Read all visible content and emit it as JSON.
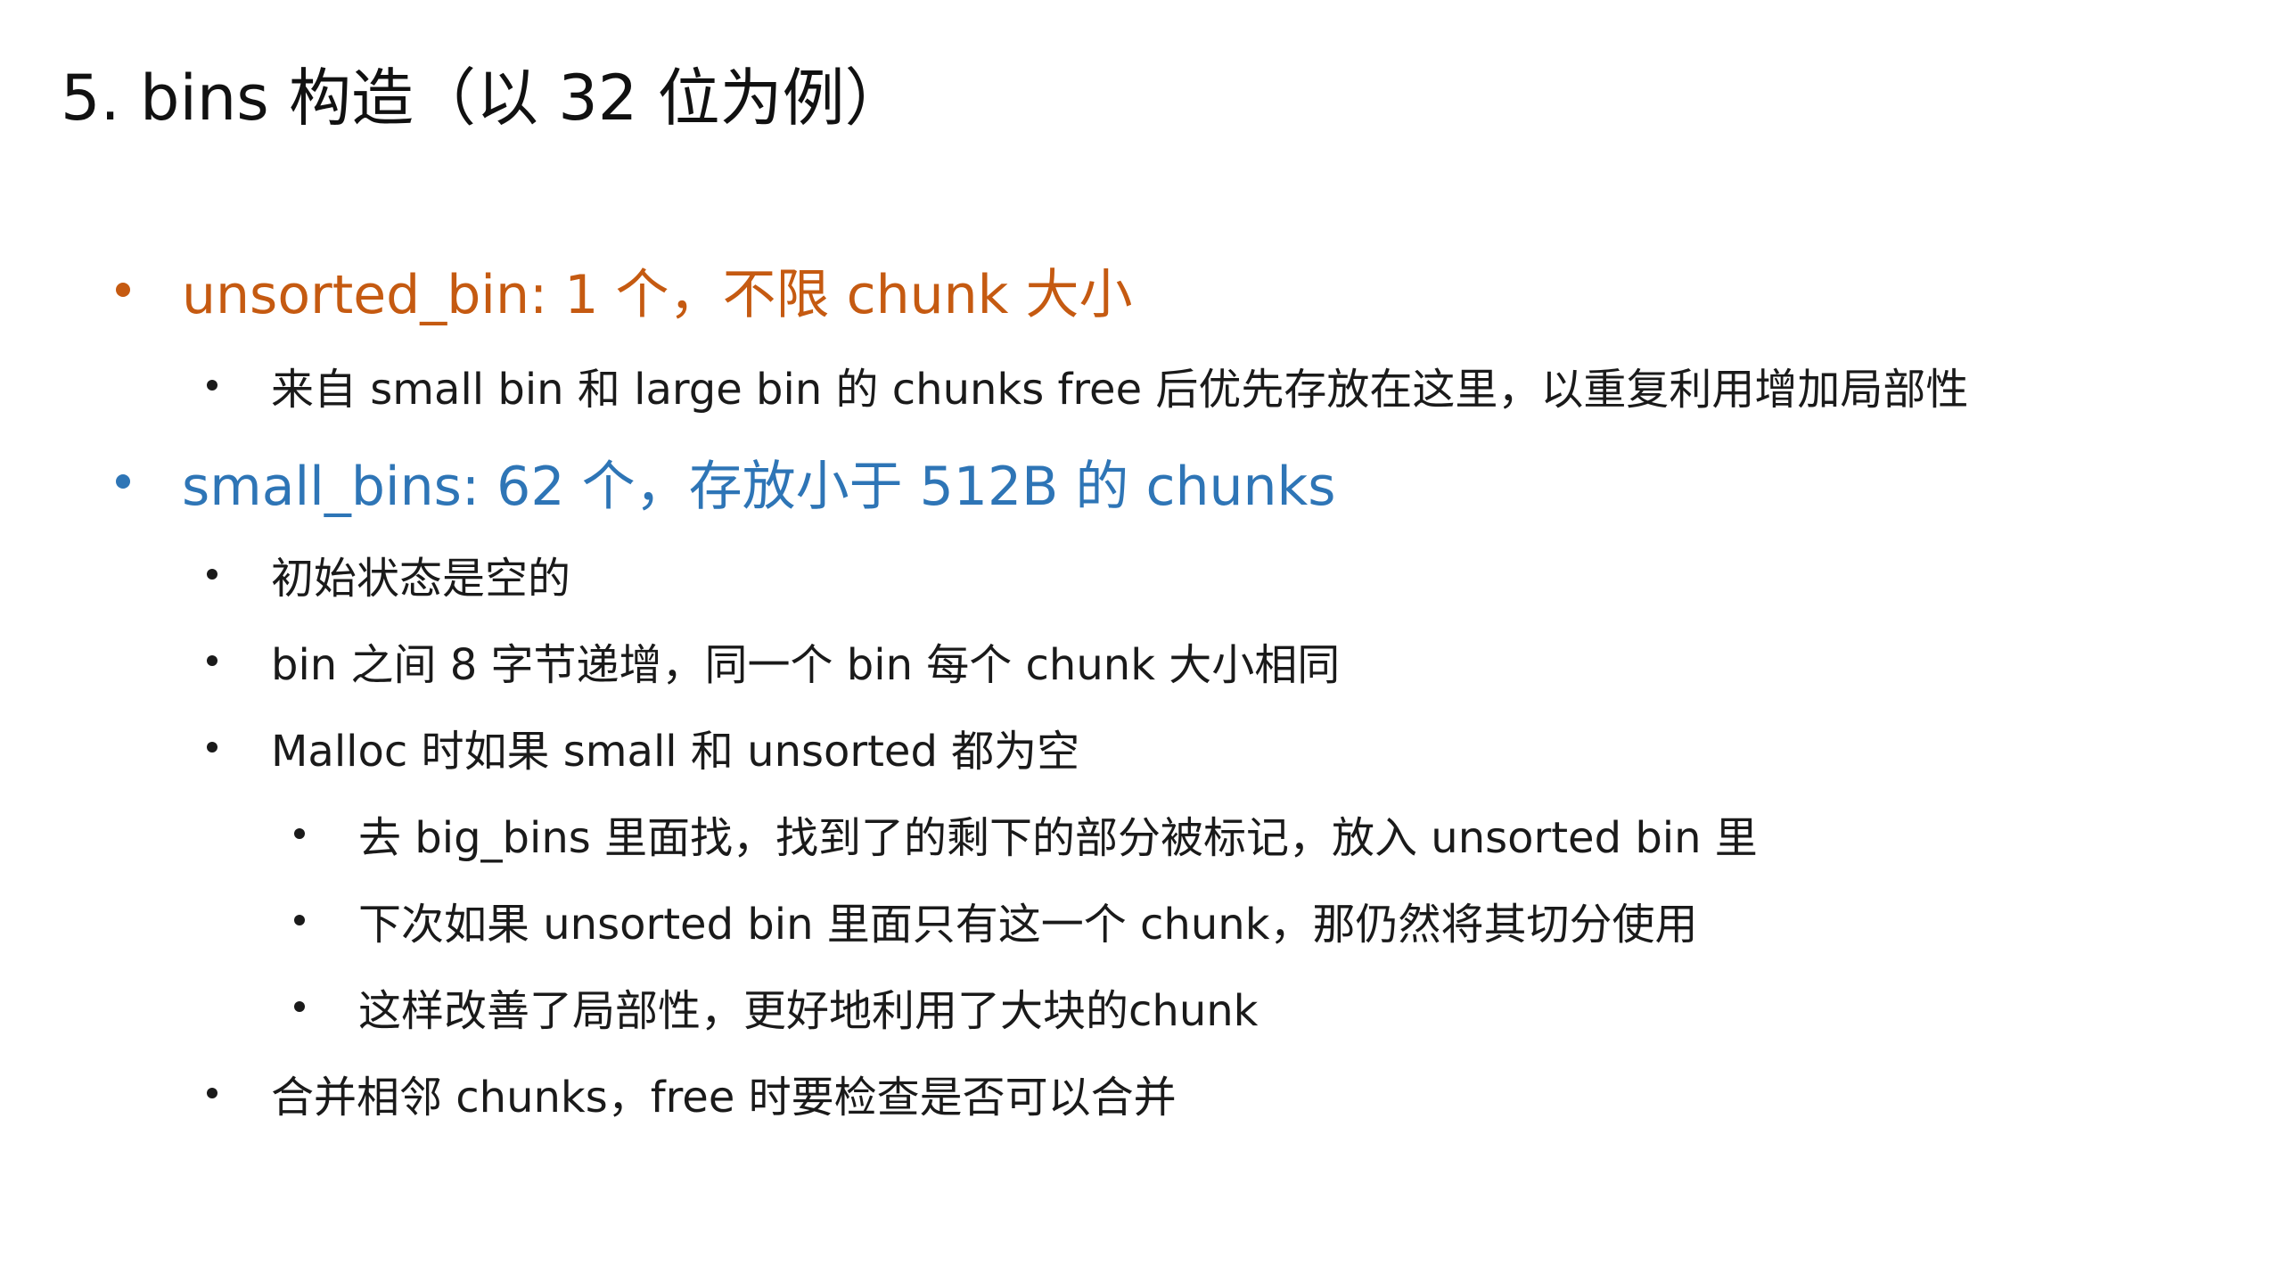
{
  "slide": {
    "title": "5. bins 构造（以 32 位为例）",
    "colors": {
      "accent_orange": "#c55a11",
      "accent_blue": "#2e75b6",
      "text": "#1a1a1a"
    },
    "bullets": [
      {
        "level": 1,
        "color": "#c55a11",
        "text": "unsorted_bin: 1 个，不限 chunk 大小"
      },
      {
        "level": 2,
        "text": "来自 small bin 和 large bin 的 chunks free 后优先存放在这里，以重复利用增加局部性"
      },
      {
        "level": 1,
        "color": "#2e75b6",
        "text": "small_bins: 62 个，存放小于 512B 的 chunks"
      },
      {
        "level": 2,
        "text": "初始状态是空的"
      },
      {
        "level": 2,
        "text": "bin 之间 8 字节递增，同一个 bin 每个 chunk 大小相同"
      },
      {
        "level": 2,
        "text": "Malloc 时如果 small 和 unsorted 都为空"
      },
      {
        "level": 3,
        "text": "去 big_bins 里面找，找到了的剩下的部分被标记，放入 unsorted bin 里"
      },
      {
        "level": 3,
        "text": "下次如果 unsorted bin 里面只有这一个 chunk，那仍然将其切分使用"
      },
      {
        "level": 3,
        "text": "这样改善了局部性，更好地利用了大块的chunk"
      },
      {
        "level": 2,
        "text": "合并相邻 chunks，free 时要检查是否可以合并"
      }
    ]
  }
}
